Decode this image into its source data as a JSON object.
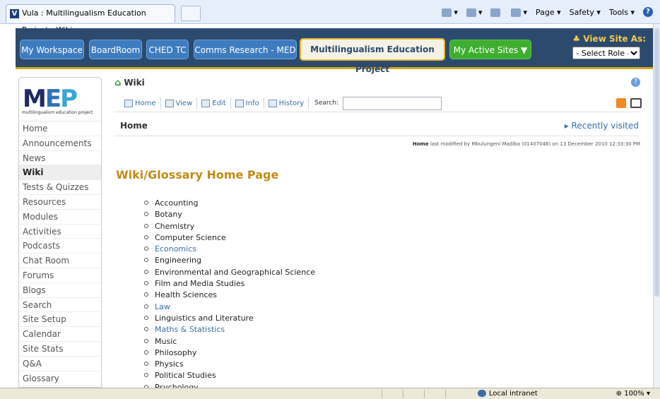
{
  "browser": {
    "tab_title": "Vula : Multilingualism Education Project : Wiki",
    "tools": [
      "Page ▾",
      "Safety ▾",
      "Tools ▾"
    ]
  },
  "site_nav": {
    "tabs": [
      "My Workspace",
      "BoardRoom",
      "CHED TC",
      "Comms Research - MED",
      "Multilingualism Education Project",
      "My Active Sites"
    ],
    "active_tab": "Multilingualism Education Project",
    "view_site_as": "View Site As:",
    "select_role": "- Select Role -"
  },
  "logo": {
    "text": "MEP",
    "subtitle": "multilingualism education project"
  },
  "tool_menu": {
    "items": [
      "Home",
      "Announcements",
      "News",
      "Wiki",
      "Tests & Quizzes",
      "Resources",
      "Modules",
      "Activities",
      "Podcasts",
      "Chat Room",
      "Forums",
      "Blogs",
      "Search",
      "Site Setup",
      "Calendar",
      "Site Stats",
      "Q&A",
      "Glossary"
    ],
    "active": "Wiki"
  },
  "wiki": {
    "title": "Wiki",
    "toolbar": [
      "Home",
      "View",
      "Edit",
      "Info",
      "History"
    ],
    "search_label": "Search:",
    "page_name": "Home",
    "recently_visited": "Recently visited",
    "modified_page": "Home",
    "modified_text": "last modified by Mbulungeni Madiba (01407046) on 13 December 2010 12:33:30 PM",
    "heading": "Wiki/Glossary Home Page",
    "entries": [
      {
        "label": "Accounting",
        "link": false
      },
      {
        "label": "Botany",
        "link": false
      },
      {
        "label": "Chemistry",
        "link": false
      },
      {
        "label": "Computer Science",
        "link": false
      },
      {
        "label": "Economics",
        "link": true
      },
      {
        "label": "Engineering",
        "link": false
      },
      {
        "label": "Environmental and Geographical Science",
        "link": false
      },
      {
        "label": "Film and Media Studies",
        "link": false
      },
      {
        "label": "Health Sciences",
        "link": false
      },
      {
        "label": "Law",
        "link": true
      },
      {
        "label": "Linguistics and Literature",
        "link": false
      },
      {
        "label": "Maths & Statistics",
        "link": true
      },
      {
        "label": "Music",
        "link": false
      },
      {
        "label": "Philosophy",
        "link": false
      },
      {
        "label": "Physics",
        "link": false
      },
      {
        "label": "Political Studies",
        "link": false
      },
      {
        "label": "Psychology",
        "link": false
      }
    ]
  },
  "status_bar": {
    "zone": "Local intranet",
    "zoom": "100%"
  },
  "colors": {
    "nav_bg": "#2b4a6e",
    "accent_gold": "#d9a81a",
    "link": "#3a6ea5",
    "heading": "#c48a14"
  }
}
